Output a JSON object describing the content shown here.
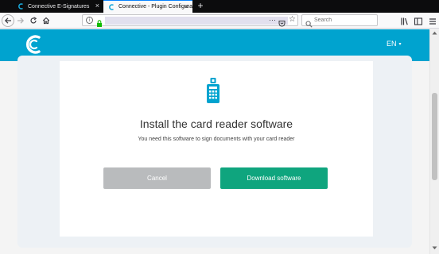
{
  "browser": {
    "tabs": [
      {
        "title": "Connective E-Signatures",
        "active": false
      },
      {
        "title": "Connective - Plugin Configurator",
        "active": true
      }
    ],
    "url_info_glyph": "i",
    "url_more_glyph": "···",
    "url_star_glyph": "☆",
    "search_placeholder": "Search",
    "new_tab_glyph": "+",
    "close_glyph": "×",
    "accent_color": "#0a84ff"
  },
  "header": {
    "brand_color": "#00a3cf",
    "language": "EN",
    "language_caret": "▾"
  },
  "dialog": {
    "title": "Install the card reader software",
    "description": "You need this software to sign documents with your card reader",
    "cancel_label": "Cancel",
    "download_label": "Download software",
    "download_color": "#0fa57e",
    "cancel_color": "#b9bbbd"
  },
  "icons": {
    "tab_favicon": "connective-favicon-icon",
    "card_reader": "card-reader-icon",
    "logo": "connective-logo"
  }
}
